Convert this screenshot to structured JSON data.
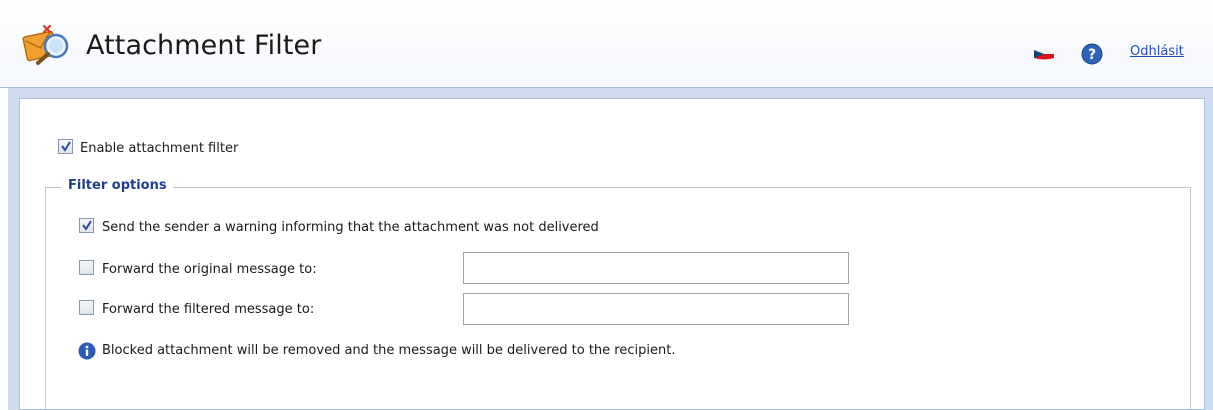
{
  "header": {
    "title": "Attachment Filter",
    "app_icon": "attachment-filter-icon",
    "language_flag": "czech-flag-icon",
    "help_icon": "help-icon",
    "logout_label": "Odhlásit"
  },
  "main": {
    "enable_filter": {
      "label": "Enable attachment filter",
      "checked": true
    },
    "filter_options": {
      "legend": "Filter options",
      "send_warning": {
        "label": "Send the sender a warning informing that the attachment was not delivered",
        "checked": true
      },
      "forward_original": {
        "label": "Forward the original message to:",
        "checked": false,
        "value": ""
      },
      "forward_filtered": {
        "label": "Forward the filtered message to:",
        "checked": false,
        "value": ""
      },
      "info_text": "Blocked attachment will be removed and the message will be delivered to the recipient."
    }
  },
  "colors": {
    "accent_blue": "#1f3f8c",
    "link_blue": "#1e4fb8",
    "page_background": "#cfdcef",
    "border": "#a9bedc"
  }
}
